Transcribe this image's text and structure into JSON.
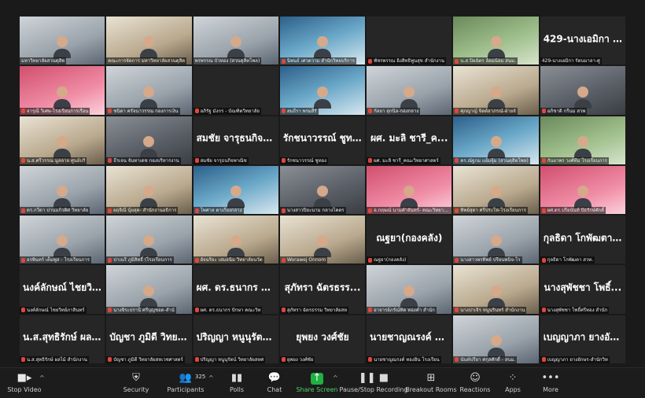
{
  "tiles": [
    {
      "name": "มหาวิทยาลัยสวนดุสิต",
      "big": "",
      "type": "video v1",
      "active": true,
      "muted": false
    },
    {
      "name": "คณะการจัดการ มหาวิทยาลัยสวนดุสิต",
      "big": "",
      "type": "video v3",
      "active": false,
      "muted": false
    },
    {
      "name": "พรพรรณ บัวทอง (สวนดุสิตโพล)",
      "big": "",
      "type": "video v1",
      "active": false,
      "muted": false
    },
    {
      "name": "นิพนธ์ เศวตวาม สำนักวิทยบริการ",
      "big": "",
      "type": "video v2",
      "active": false,
      "muted": true
    },
    {
      "name": "พัชรพรรณ อิงสิทธิพูนสุข สำนักงาน",
      "big": "",
      "type": "",
      "active": false,
      "muted": true
    },
    {
      "name": "น.ส.ปิยฉัตร ล้อมน้อม สนม.",
      "big": "",
      "type": "video v5",
      "active": false,
      "muted": true
    },
    {
      "name": "429-นางเอมิกา รัตนมาลา-ศู",
      "big": "429-นางเอมิกา รั...",
      "type": "",
      "active": false,
      "muted": false
    },
    {
      "name": "จารุณี วิเศษ-โรงเรียนการเรือน",
      "big": "",
      "type": "video v4",
      "active": false,
      "muted": true
    },
    {
      "name": "ชนิดา ครัจนาวรรณ กองการเงิน",
      "big": "",
      "type": "video v1",
      "active": false,
      "muted": true
    },
    {
      "name": "อภิรัฐ มังกร - บัณฑิตวิทยาลัย",
      "big": "",
      "type": "",
      "active": false,
      "muted": true
    },
    {
      "name": "สมธีรา พรมสีรั",
      "big": "",
      "type": "video v2",
      "active": false,
      "muted": true
    },
    {
      "name": "กัลยา สุกนิล-กองกลาง",
      "big": "",
      "type": "video v1",
      "active": false,
      "muted": true
    },
    {
      "name": "ศุภญาญ์ จิตต์อาภรณ์-ฝ่ายจั",
      "big": "",
      "type": "video v3",
      "active": false,
      "muted": true
    },
    {
      "name": "อภิชาติ กรีนม สวพ",
      "big": "",
      "type": "video",
      "active": false,
      "muted": true
    },
    {
      "name": "น.ส.ศรีวรรณ มูลลาย ศูนย์บริ",
      "big": "",
      "type": "video v3",
      "active": false,
      "muted": true
    },
    {
      "name": "ธีรเจน จันทาเดช กองบริหารงาน",
      "big": "",
      "type": "video",
      "active": false,
      "muted": true
    },
    {
      "name": "สมชัย จารุธนกิจพาณิช",
      "big": "สมชัย จารุธนกิจพ...",
      "type": "",
      "active": false,
      "muted": true
    },
    {
      "name": "รักชนาวรรณ์ ชูทอง",
      "big": "รักชนาวรรณ์ ชูทอง",
      "type": "",
      "active": false,
      "muted": true
    },
    {
      "name": "ผศ. มะลิ ชารี_คณะวิทยาศาสตร์",
      "big": "ผศ. มะลิ ชารี_ค...",
      "type": "",
      "active": false,
      "muted": true
    },
    {
      "name": "ดร.ณัฐกม แย้มจุ้ม (สวนดุสิตโพล)",
      "big": "",
      "type": "video v2",
      "active": false,
      "muted": true
    },
    {
      "name": "กันยาพร วงศ์ทีม โรงเรียนการ",
      "big": "",
      "type": "video v5",
      "active": false,
      "muted": true
    },
    {
      "name": "ดร.กวีดา ปานแก้วดิศ วิทยาลัย",
      "big": "",
      "type": "video v1",
      "active": false,
      "muted": true
    },
    {
      "name": "ผฤจิณี นุ้ยสุด- สำนักงานอธิการ",
      "big": "",
      "type": "video v3",
      "active": false,
      "muted": true
    },
    {
      "name": "โพศาล ดาเกียงกลาง",
      "big": "",
      "type": "video v2",
      "active": false,
      "muted": true
    },
    {
      "name": "นางสาวปิยะนาม กลางโคตร",
      "big": "",
      "type": "video",
      "active": false,
      "muted": true
    },
    {
      "name": "อ.กฤษณ์ นามคำจันทร์- คณะวิทยาศาสตร์",
      "big": "",
      "type": "video v4",
      "active": false,
      "muted": true
    },
    {
      "name": "ทิพย์สุดา ศรีประโห-โรงเรียนการ",
      "big": "",
      "type": "video v3",
      "active": false,
      "muted": true
    },
    {
      "name": "ผศ.ดร.ปรียนันท์ ปัธรักษ์ศักดิ์",
      "big": "",
      "type": "video v4",
      "active": false,
      "muted": true
    },
    {
      "name": "อรพินทร์ เต็มพูล - โรงเรียนการ",
      "big": "",
      "type": "video v1",
      "active": false,
      "muted": true
    },
    {
      "name": "ปาเนรี ภูมิสิทธิ์ (โรงเรียนการ",
      "big": "",
      "type": "video v1",
      "active": false,
      "muted": true
    },
    {
      "name": "อัจฉริยะ เสมอนิม วิทยาลัยนวัต",
      "big": "",
      "type": "video v3",
      "active": false,
      "muted": true
    },
    {
      "name": "Worawej Onnom",
      "big": "",
      "type": "video v3",
      "active": false,
      "muted": true
    },
    {
      "name": "ณฐยา(กองคลัง)",
      "big": "ณฐยา(กองคลัง)",
      "type": "",
      "active": false,
      "muted": true
    },
    {
      "name": "นางสาวพรทิพย์ ปรียนพนิจ-โร",
      "big": "",
      "type": "video v1",
      "active": false,
      "muted": true
    },
    {
      "name": "กุลธิดา โกพัฒตา สวท.",
      "big": "กุลธิดา โกพัฒตา...",
      "type": "",
      "active": false,
      "muted": true
    },
    {
      "name": "นงค์ลักษณ์ ไชยวิทย์ภาสินทร์",
      "big": "นงค์ลักษณ์ ไชยวิ...",
      "type": "",
      "active": false,
      "muted": true
    },
    {
      "name": "นางจิระปรานี ศรีบุญชอด-สำนั",
      "big": "",
      "type": "video v1",
      "active": false,
      "muted": true
    },
    {
      "name": "ผศ. ดร.ธนากร ปักษา คณะวิท",
      "big": "ผศ. ดร.ธนากร ปั...",
      "type": "",
      "active": false,
      "muted": true
    },
    {
      "name": "สุภัทรา ฉัตรธรรม วิทยาลัยสห",
      "big": "สุภัทรา ฉัตรธรร...",
      "type": "",
      "active": false,
      "muted": true
    },
    {
      "name": "อาจารย์ภรัณ์ทิต ทองคำ สำนัก",
      "big": "",
      "type": "video v1",
      "active": false,
      "muted": true
    },
    {
      "name": "นางปาเจิร หนูนรินทร์ สำนักงาน",
      "big": "",
      "type": "video v3",
      "active": false,
      "muted": true
    },
    {
      "name": "นางสุพัชชา โพธิ์ศรีทอง สำนัก",
      "big": "นางสุพัชชา โพธิ์...",
      "type": "",
      "active": false,
      "muted": true
    },
    {
      "name": "น.ส.สุทธิรักษ์ ผลไม้ สำนักงาน",
      "big": "น.ส.สุทธิรักษ์ ผลไ...",
      "type": "",
      "active": false,
      "muted": true
    },
    {
      "name": "บัญชา ภูมิดี วิทยาลัยสหเวชศาสตร์",
      "big": "บัญชา ภูมิดี วิทยา...",
      "type": "",
      "active": false,
      "muted": true
    },
    {
      "name": "ปริญญา หนูนุรัตน์ วิทยาลัยสหศ",
      "big": "ปริญญา หนูนุรัตน์...",
      "type": "",
      "active": false,
      "muted": true
    },
    {
      "name": "ยุพยง วงศ์ชัย",
      "big": "ยุพยง วงศ์ชัย",
      "type": "",
      "active": false,
      "muted": true
    },
    {
      "name": "นายชาญณรงค์ ทองอิน โรงเรียน",
      "big": "นายชาญณรงค์ ท...",
      "type": "",
      "active": false,
      "muted": true
    },
    {
      "name": "นันท์ปรียา ศกุลศักดิ์ - สนม.",
      "big": "",
      "type": "video v1",
      "active": false,
      "muted": true
    },
    {
      "name": "เบญญาภา ยางอักษร-สำนักวิท",
      "big": "เบญญาภา ยางอัก...",
      "type": "",
      "active": false,
      "muted": true
    }
  ],
  "toolbar": {
    "stop_video": "Stop Video",
    "security": "Security",
    "participants": "Participants",
    "participant_count": "325",
    "polls": "Polls",
    "chat": "Chat",
    "share_screen": "Share Screen",
    "pause_recording": "Pause/Stop Recording",
    "breakout": "Breakout Rooms",
    "reactions": "Reactions",
    "apps": "Apps",
    "more": "More"
  },
  "colors": {
    "active_border": "#e6e84d",
    "share_green": "#1fb141",
    "muted_red": "#e0473b"
  }
}
